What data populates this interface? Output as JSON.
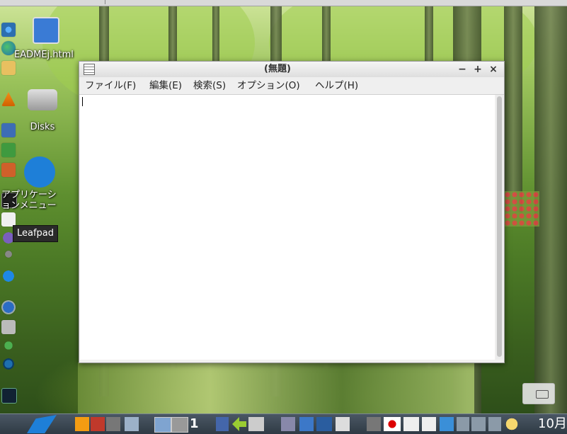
{
  "window": {
    "title": "(無題)",
    "minimize_glyph": "−",
    "maximize_glyph": "+",
    "close_glyph": "×",
    "menu": [
      "ファイル(F)",
      "編集(E)",
      "検索(S)",
      "オプション(O)",
      "ヘルプ(H)"
    ],
    "text": ""
  },
  "desktop_icons": {
    "readme": "EADMEj.html",
    "disks": "Disks",
    "appmenu_line1": "アプリケーシ",
    "appmenu_line2": "ョンメニュー"
  },
  "tooltip": "Leafpad",
  "taskbar": {
    "workspace_number": "1",
    "clock": "10月"
  }
}
